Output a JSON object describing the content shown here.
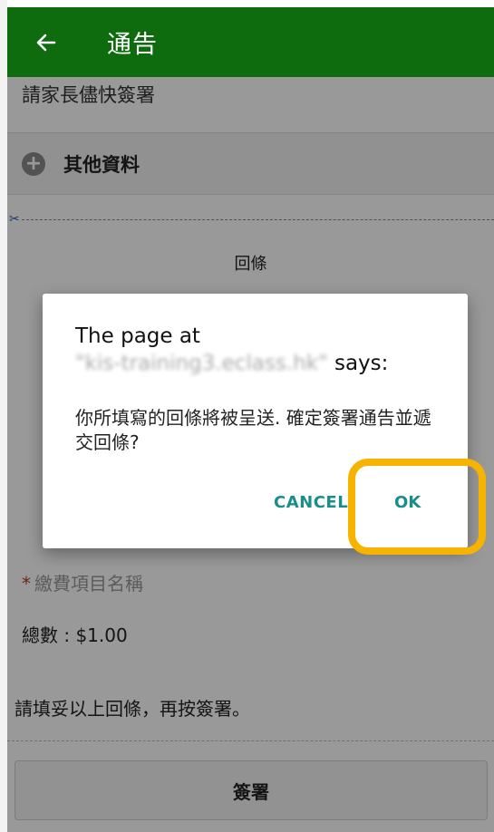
{
  "appbar": {
    "back_icon": "arrow-left-icon",
    "title": "通告"
  },
  "content": {
    "parent_sign_text": "請家長儘快簽署",
    "other_info": {
      "icon": "plus-circle-icon",
      "label": "其他資料"
    },
    "cut_icon": "scissors-icon",
    "reply_title": "回條",
    "fee_item": {
      "required_mark": "*",
      "label": "繳費項目名稱"
    },
    "total": "總數 : $1.00",
    "hint": "請填妥以上回條，再按簽署。",
    "sign_button": "簽署"
  },
  "dialog": {
    "title_prefix": "The page at ",
    "title_url": "\"kis-training3.eclass.hk\"",
    "title_suffix": " says:",
    "message": "你所填寫的回條將被呈送. 確定簽署通告並遞交回條?",
    "cancel_label": "CANCEL",
    "ok_label": "OK"
  },
  "colors": {
    "appbar": "#0e6b0e",
    "dialog_button": "#1a8e8a",
    "highlight": "#f6b400"
  }
}
